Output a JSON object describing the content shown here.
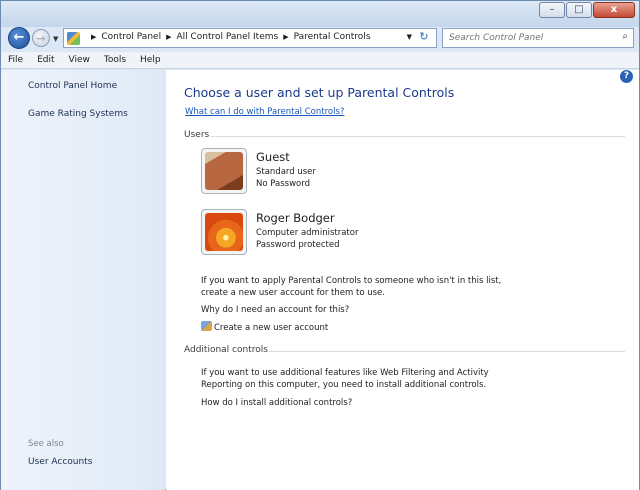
{
  "titlebar": {
    "minimize_glyph": "–",
    "maximize_glyph": "□",
    "close_glyph": "x"
  },
  "nav": {
    "back_glyph": "←",
    "forward_glyph": "→"
  },
  "address": {
    "crumbs": [
      "Control Panel",
      "All Control Panel Items",
      "Parental Controls"
    ],
    "search_placeholder": "Search Control Panel"
  },
  "menu": [
    "File",
    "Edit",
    "View",
    "Tools",
    "Help"
  ],
  "sidebar": {
    "home": "Control Panel Home",
    "rating": "Game Rating Systems",
    "see_also": "See also",
    "user_accounts": "User Accounts"
  },
  "main": {
    "title": "Choose a user and set up Parental Controls",
    "what_link": "What can I do with Parental Controls?",
    "users_head": "Users",
    "users": [
      {
        "name": "Guest",
        "type": "Standard user",
        "password": "No Password",
        "icon": "briefcase-avatar"
      },
      {
        "name": "Roger Bodger",
        "type": "Computer administrator",
        "password": "Password protected",
        "icon": "flower-avatar"
      }
    ],
    "info_line1": "If you want to apply Parental Controls to someone who isn't in this list,",
    "info_line2": "create a new user account for them to use.",
    "why_link": "Why do I need an account for this?",
    "create_link": "Create a new user account",
    "additional_head": "Additional controls",
    "add_line1": "If you want to use additional features like Web Filtering and Activity",
    "add_line2": "Reporting on this computer, you need to install additional controls.",
    "install_link": "How do I install additional controls?"
  },
  "colors": {
    "link": "#1b58b8",
    "title": "#1a3a8a",
    "sidebar": "#e4edf8"
  }
}
